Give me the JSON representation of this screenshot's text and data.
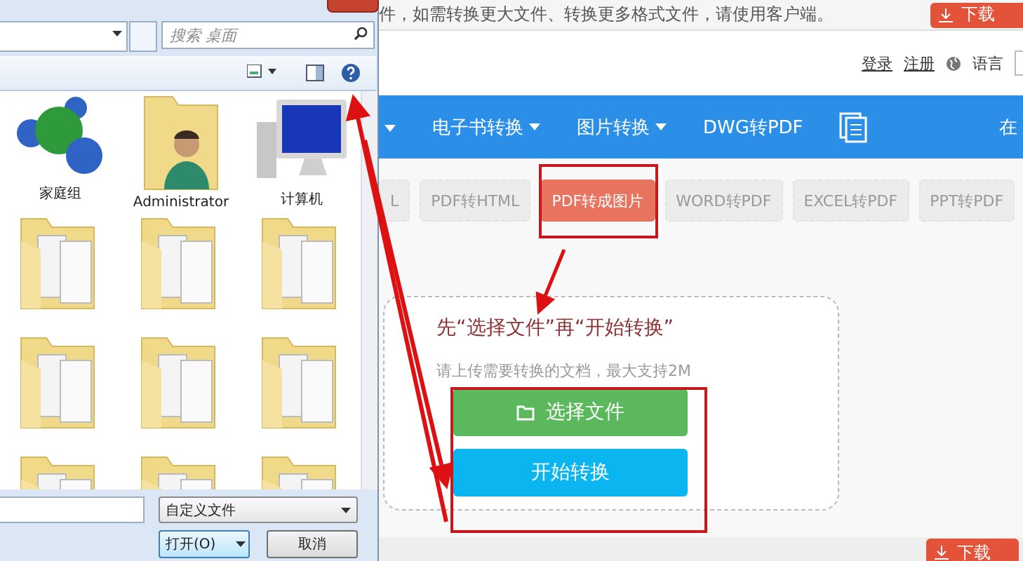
{
  "notice": {
    "text": "件，如需转换更大文件、转换更多格式文件，请使用客户端。",
    "button": "下载"
  },
  "header_links": [
    "登录",
    "注册"
  ],
  "language": "语言",
  "nav": [
    {
      "label": "电子书转换",
      "dropdown": true
    },
    {
      "label": "图片转换",
      "dropdown": true
    },
    {
      "label": "DWG转PDF",
      "dropdown": false
    }
  ],
  "nav_right": "在",
  "tools": [
    {
      "label": "L",
      "selected": false
    },
    {
      "label": "PDF转HTML",
      "selected": false
    },
    {
      "label": "PDF转成图片",
      "selected": true
    },
    {
      "label": "WORD转PDF",
      "selected": false
    },
    {
      "label": "EXCEL转PDF",
      "selected": false
    },
    {
      "label": "PPT转PDF",
      "selected": false
    }
  ],
  "upload": {
    "title": "先“选择文件”再“开始转换”",
    "hint": "请上传需要转换的文档，最大支持2M",
    "select_button": "选择文件",
    "start_button": "开始转换"
  },
  "footer": {
    "button": "下载"
  },
  "dialog": {
    "search": {
      "placeholder": "搜索 桌面"
    },
    "items": [
      {
        "label": "家庭组",
        "kind": "homegroup"
      },
      {
        "label": "Administrator",
        "kind": "user"
      },
      {
        "label": "计算机",
        "kind": "computer"
      },
      {
        "kind": "folder"
      },
      {
        "kind": "folder"
      },
      {
        "kind": "folder"
      },
      {
        "kind": "folder"
      },
      {
        "kind": "folder"
      },
      {
        "kind": "folder"
      },
      {
        "kind": "folder"
      },
      {
        "kind": "folder"
      },
      {
        "kind": "folder"
      }
    ],
    "file_type": "自定义文件",
    "buttons": [
      "打开(O)",
      "取消"
    ]
  }
}
